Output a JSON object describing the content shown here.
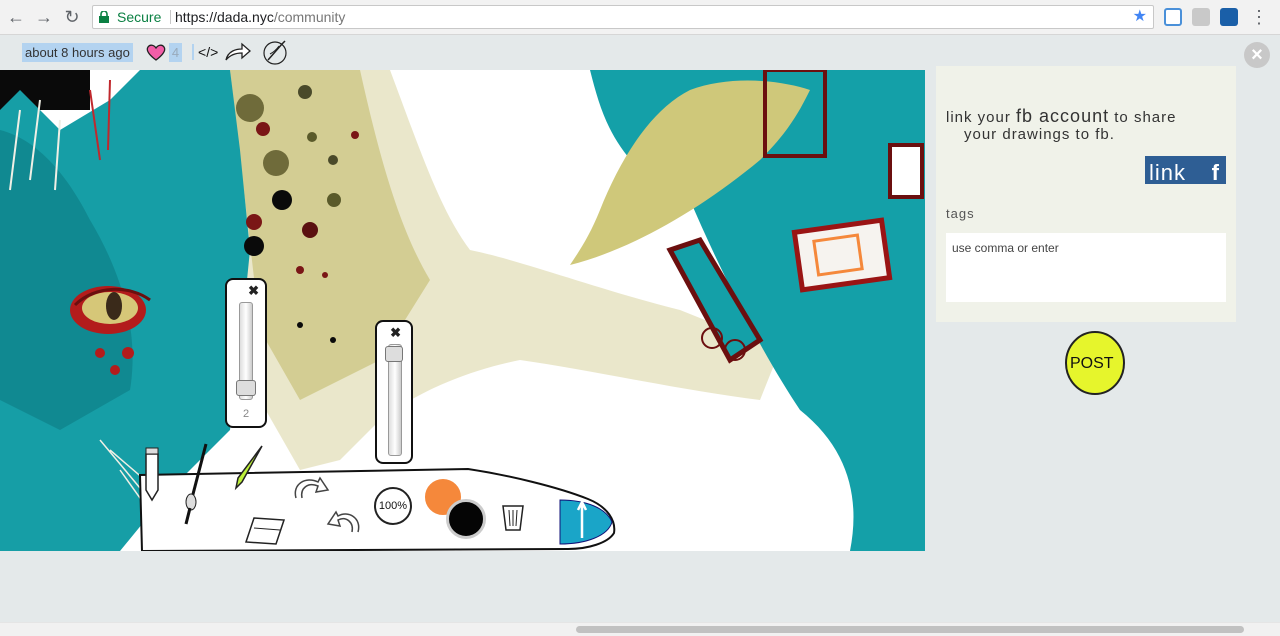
{
  "browser": {
    "secure_label": "Secure",
    "url_host": "https://dada.nyc",
    "url_path": "/community"
  },
  "post": {
    "timestamp": "about 8 hours ago",
    "like_count": "4",
    "embed_label": "</>"
  },
  "toolbar": {
    "brush_size_value": "2",
    "opacity_label": "100%",
    "primary_color": "#f5883b",
    "secondary_color": "#050505",
    "accent_color": "#1aa5c8"
  },
  "panel": {
    "fb_text_a": "link your ",
    "fb_text_b": "fb account",
    "fb_text_c": " to share",
    "fb_text_d": "your drawings to fb.",
    "link_label": "link",
    "link_icon": "f",
    "tags_label": "tags",
    "tags_placeholder": "use comma or enter",
    "post_label": "POST"
  }
}
